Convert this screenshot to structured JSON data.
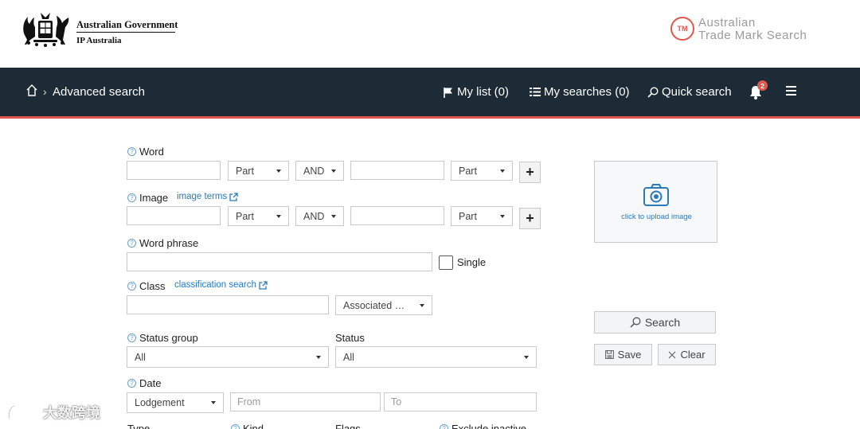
{
  "header": {
    "gov_name": "Australian Government",
    "gov_sub": "IP Australia",
    "tm_badge": "TM",
    "tm_line1": "Australian",
    "tm_line2": "Trade Mark Search"
  },
  "nav": {
    "breadcrumb": "Advanced search",
    "my_list": "My list (0)",
    "my_searches": "My searches (0)",
    "quick_search": "Quick search",
    "notifications": "2"
  },
  "form": {
    "word": {
      "label": "Word",
      "match1": "Part",
      "operator": "AND",
      "match2": "Part"
    },
    "image": {
      "label": "Image",
      "terms_link": "image terms",
      "match1": "Part",
      "operator": "AND",
      "match2": "Part"
    },
    "word_phrase": {
      "label": "Word phrase",
      "single_label": "Single"
    },
    "class": {
      "label": "Class",
      "link": "classification search",
      "associated": "Associated …"
    },
    "status_group": {
      "label": "Status group",
      "value": "All"
    },
    "status": {
      "label": "Status",
      "value": "All"
    },
    "date": {
      "label": "Date",
      "type": "Lodgement",
      "from_placeholder": "From",
      "to_placeholder": "To"
    },
    "bottom_labels": {
      "type": "Type",
      "kind": "Kind",
      "flags": "Flags",
      "exclude": "Exclude inactive"
    }
  },
  "sidebar": {
    "upload_text": "click to upload image",
    "search_button": "Search",
    "save_button": "Save",
    "clear_button": "Clear"
  },
  "watermark": {
    "text": "大数跨境"
  },
  "colors": {
    "nav_bg": "#1c2b35",
    "accent": "#e2574c",
    "link": "#2a7ab8"
  }
}
